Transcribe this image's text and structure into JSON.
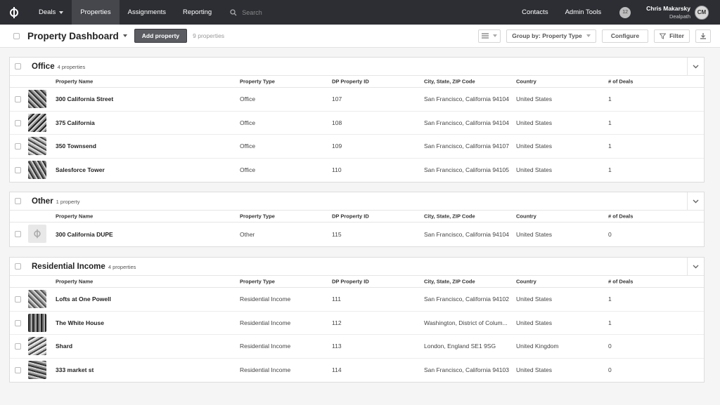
{
  "nav": {
    "items": [
      {
        "label": "Deals"
      },
      {
        "label": "Properties"
      },
      {
        "label": "Assignments"
      },
      {
        "label": "Reporting"
      }
    ],
    "search_placeholder": "Search",
    "contacts": "Contacts",
    "admin_tools": "Admin Tools",
    "notification_count": "12",
    "user_name": "Chris Makarsky",
    "user_org": "Dealpath",
    "user_initials": "CM"
  },
  "header": {
    "title": "Property Dashboard",
    "add_button": "Add property",
    "property_count": "9 properties",
    "group_by": "Group by: Property Type",
    "configure": "Configure",
    "filter": "Filter"
  },
  "columns": [
    "Property Name",
    "Property Type",
    "DP Property ID",
    "City, State, ZIP Code",
    "Country",
    "# of Deals"
  ],
  "groups": [
    {
      "title": "Office",
      "count": "4 properties",
      "rows": [
        {
          "name": "300 California Street",
          "type": "Office",
          "id": "107",
          "city": "San Francisco, California 94104",
          "country": "United States",
          "deals": "1"
        },
        {
          "name": "375 California",
          "type": "Office",
          "id": "108",
          "city": "San Francisco, California 94104",
          "country": "United States",
          "deals": "1"
        },
        {
          "name": "350 Townsend",
          "type": "Office",
          "id": "109",
          "city": "San Francisco, California 94107",
          "country": "United States",
          "deals": "1"
        },
        {
          "name": "Salesforce Tower",
          "type": "Office",
          "id": "110",
          "city": "San Francisco, California 94105",
          "country": "United States",
          "deals": "1"
        }
      ]
    },
    {
      "title": "Other",
      "count": "1 property",
      "rows": [
        {
          "name": "300 California DUPE",
          "type": "Other",
          "id": "115",
          "city": "San Francisco, California 94104",
          "country": "United States",
          "deals": "0"
        }
      ]
    },
    {
      "title": "Residential Income",
      "count": "4 properties",
      "rows": [
        {
          "name": "Lofts at One Powell",
          "type": "Residential Income",
          "id": "111",
          "city": "San Francisco, California 94102",
          "country": "United States",
          "deals": "1"
        },
        {
          "name": "The White House",
          "type": "Residential Income",
          "id": "112",
          "city": "Washington, District of Colum...",
          "country": "United States",
          "deals": "1"
        },
        {
          "name": "Shard",
          "type": "Residential Income",
          "id": "113",
          "city": "London, England SE1 9SG",
          "country": "United Kingdom",
          "deals": "0"
        },
        {
          "name": "333 market st",
          "type": "Residential Income",
          "id": "114",
          "city": "San Francisco, California 94103",
          "country": "United States",
          "deals": "0"
        }
      ]
    }
  ]
}
